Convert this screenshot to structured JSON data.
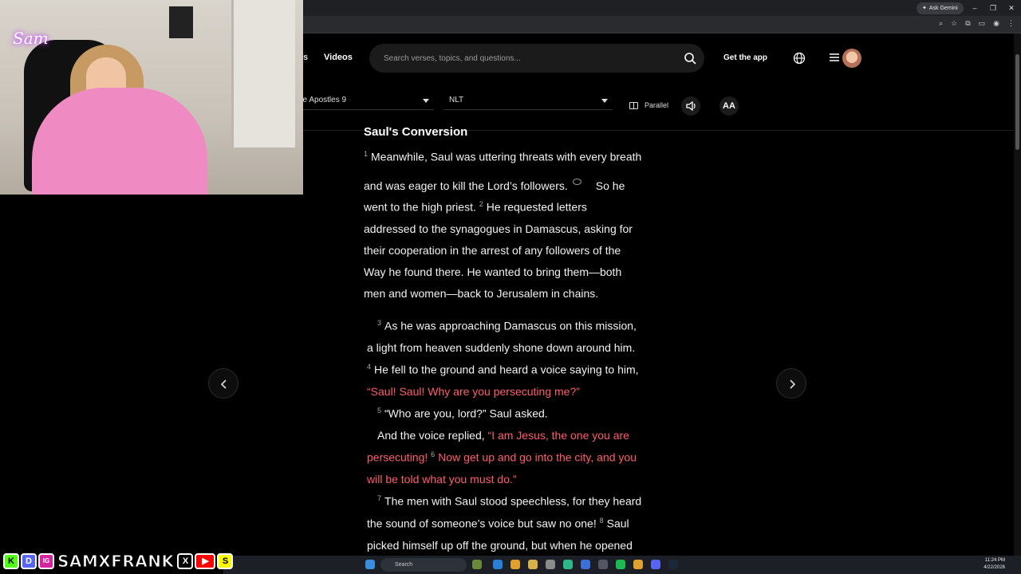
{
  "browser": {
    "gemini_label": "Ask Gemini",
    "window_controls": [
      "–",
      "❐",
      "✕"
    ]
  },
  "header": {
    "nav_partial": "s",
    "nav_videos": "Videos",
    "search_placeholder": "Search verses, topics, and questions...",
    "get_app": "Get the app",
    "book": "he Apostles 9",
    "version": "NLT",
    "parallel": "Parallel",
    "font_size": "AA"
  },
  "reader": {
    "section_title": "Saul's Conversion",
    "lines": [
      {
        "vnum": "1",
        "text": "Meanwhile, Saul was uttering threats with every breath"
      },
      {
        "text": "and was eager to kill the Lord’s followers.",
        "after": "So he"
      },
      {
        "text": "went to the high priest.",
        "vnum2": "2",
        "text2": "He requested letters"
      },
      {
        "text": "addressed to the synagogues in Damascus, asking for"
      },
      {
        "text": "their cooperation in the arrest of any followers of the"
      },
      {
        "text": "Way he found there. He wanted to bring them—both"
      },
      {
        "text": "men and women—back to Jerusalem in chains."
      },
      {
        "vnum": "3",
        "text": "As he was approaching Damascus on this mission,"
      },
      {
        "text": "a light from heaven suddenly shone down around him."
      },
      {
        "vnum": "4",
        "text": "He fell to the ground and heard a voice saying to him,"
      },
      {
        "red": "“Saul! Saul! Why are you persecuting me?”"
      },
      {
        "vnum": "5",
        "text": "“Who are you, lord?” Saul asked."
      },
      {
        "text": "And the voice replied,",
        "red": "“I am Jesus, the one you are"
      },
      {
        "red": "persecuting!",
        "vnum2": "6",
        "red2": "Now get up and go into the city, and you"
      },
      {
        "red": "will be told what you must do.”"
      },
      {
        "vnum": "7",
        "text": "The men with Saul stood speechless, for they heard"
      },
      {
        "text": "the sound of someone’s voice but saw no one!",
        "vnum2": "8",
        "text2": "Saul"
      },
      {
        "text": "picked himself up off the ground, but when he opened"
      }
    ]
  },
  "webcam": {
    "logo": "Sam"
  },
  "social": {
    "handle": "SAMXFRANK",
    "icons": [
      "K",
      "D",
      "IG",
      "X",
      "▶",
      "S"
    ]
  },
  "taskbar": {
    "search_label": "Search",
    "time": "11:24 PM",
    "date": "4/22/2026"
  },
  "colors": {
    "words_of_jesus": "#ff5d6c",
    "background": "#000000"
  }
}
